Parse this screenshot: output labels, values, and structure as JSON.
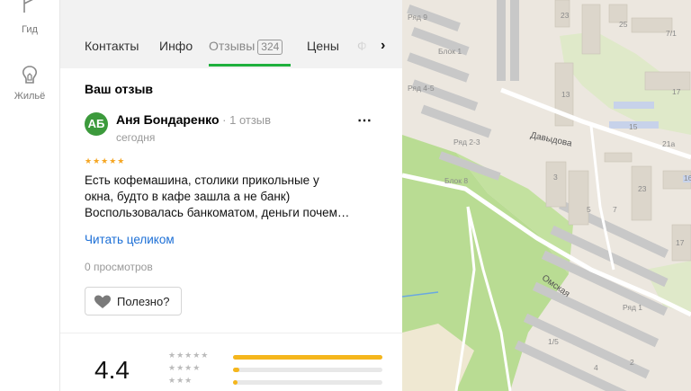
{
  "rail": {
    "items": [
      {
        "label": "Гид",
        "icon": "flag-icon"
      },
      {
        "label": "Жильё",
        "icon": "home-icon"
      }
    ]
  },
  "tabs": {
    "items": [
      {
        "label": "Контакты"
      },
      {
        "label": "Инфо"
      },
      {
        "label": "Отзывы",
        "count": "324",
        "active": true
      },
      {
        "label": "Цены"
      },
      {
        "label": "Ф"
      }
    ]
  },
  "review_section": {
    "heading": "Ваш отзыв"
  },
  "review": {
    "avatar_initials": "АБ",
    "author": "Аня Бондаренко",
    "author_meta": " · 1 отзыв",
    "date": "сегодня",
    "stars": "★★★★★",
    "rating": 5,
    "text_lines": [
      "Есть кофемашина, столики прикольные у",
      "окна, будто в кафе зашла а не банк)",
      "Воспользовалась банкоматом, деньги почем…"
    ],
    "read_more": "Читать целиком",
    "views": "0 просмотров",
    "useful_label": "Полезно?"
  },
  "summary": {
    "rating": "4.4",
    "distribution": [
      {
        "stars": "★★★★★",
        "fraction": 1.0
      },
      {
        "stars": "★★★★",
        "fraction": 0.04
      },
      {
        "stars": "★★★",
        "fraction": 0.03
      }
    ]
  },
  "map": {
    "labels": [
      "Ряд 9",
      "Блок 1",
      "Ряд 4-5",
      "Ряд 2-3",
      "Блок 8",
      "Ряд 1",
      "23",
      "25",
      "7/1",
      "13",
      "17",
      "15",
      "21а",
      "16",
      "3",
      "5",
      "7",
      "23",
      "17",
      "1/5",
      "4",
      "2"
    ],
    "streets": [
      "Давыдова",
      "Омская"
    ]
  },
  "colors": {
    "accent_green": "#1fb03d",
    "link_blue": "#1c6fd6",
    "star_orange": "#f5a623",
    "avatar_green": "#3c9a3c"
  }
}
